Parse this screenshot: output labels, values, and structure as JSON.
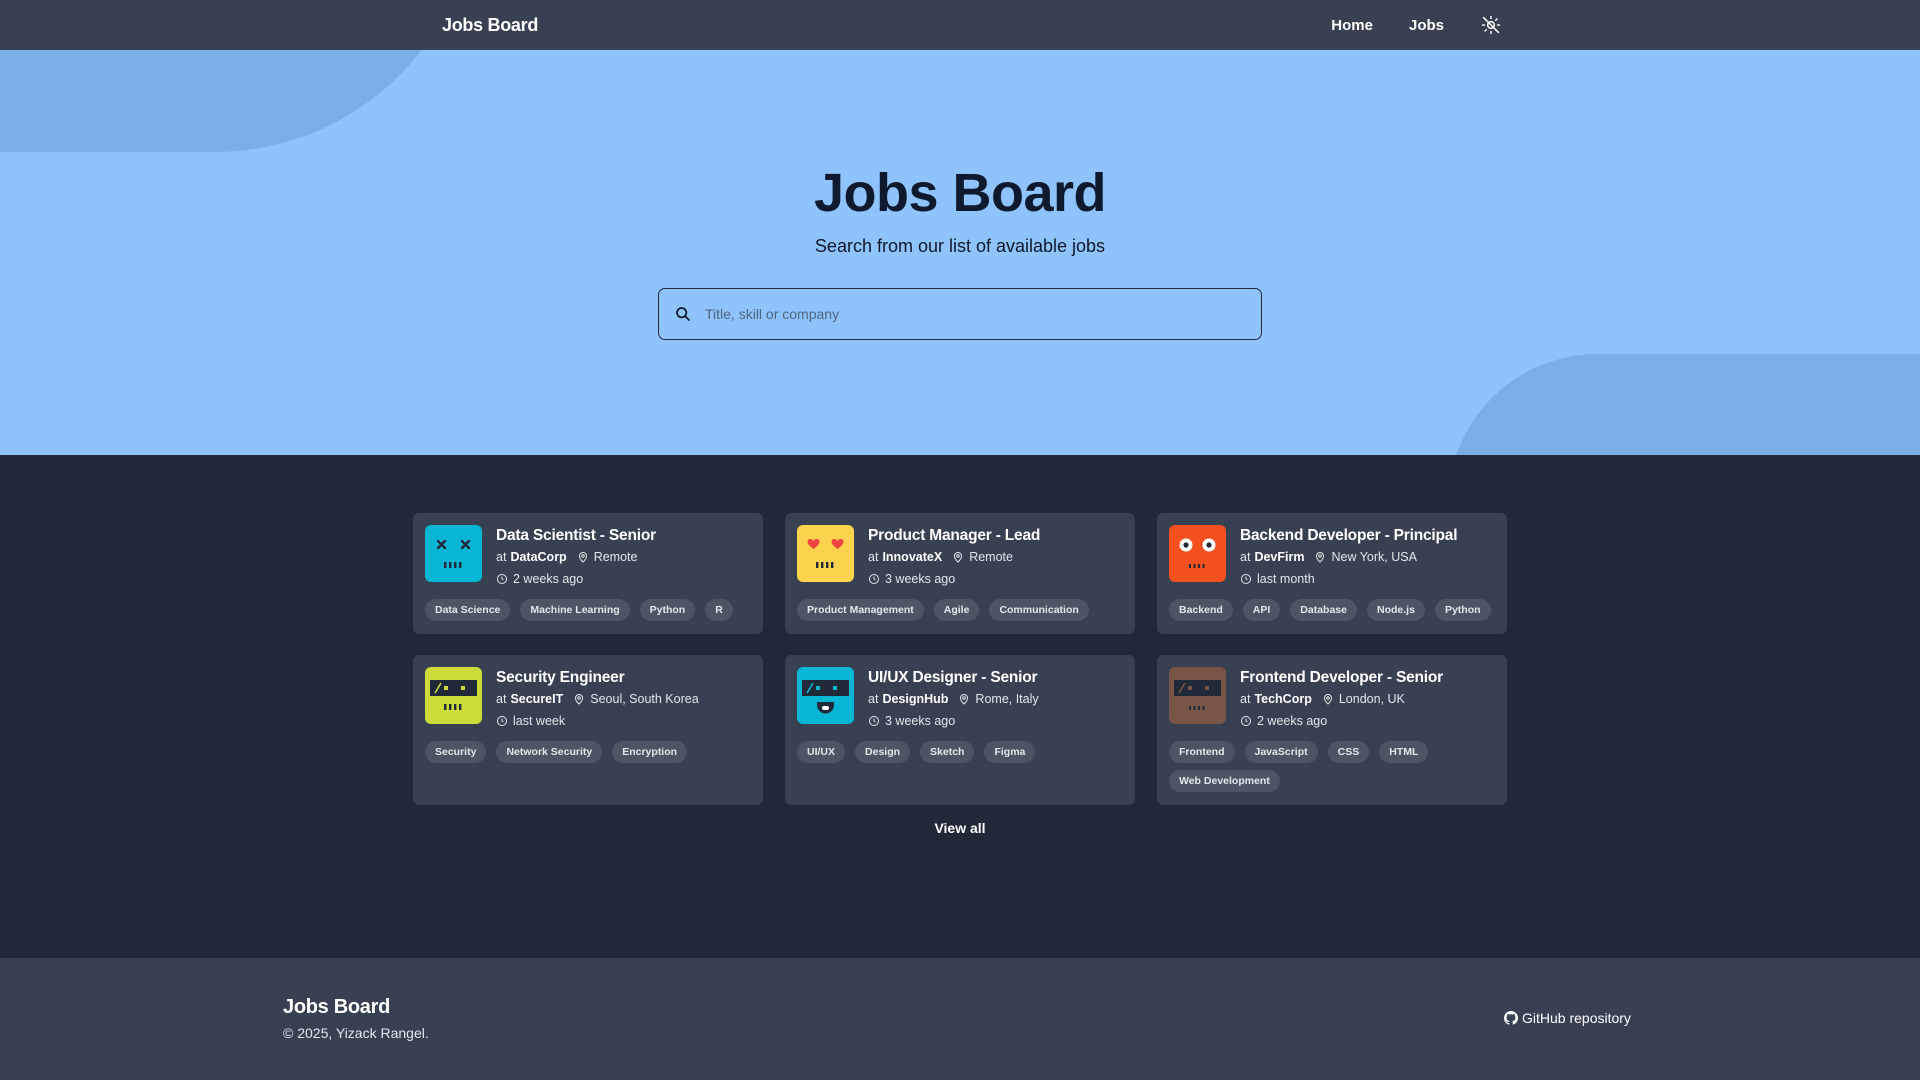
{
  "navbar": {
    "brand": "Jobs Board",
    "links": [
      {
        "label": "Home"
      },
      {
        "label": "Jobs"
      }
    ],
    "theme_toggle_icon": "sun-off-icon"
  },
  "hero": {
    "title": "Jobs Board",
    "subtitle": "Search from our list of available jobs",
    "search": {
      "placeholder": "Title, skill or company",
      "value": "",
      "icon": "search-icon"
    },
    "colors": {
      "background": "#8ec3fc",
      "blob": "#7aaee6"
    }
  },
  "jobs": [
    {
      "title": "Data Scientist - Senior",
      "at": "at",
      "company": "DataCorp",
      "location": "Remote",
      "posted": "2 weeks ago",
      "avatar": {
        "color": "#06b6d4",
        "face": "dead-x-eyes"
      },
      "tags": [
        "Data Science",
        "Machine Learning",
        "Python",
        "R"
      ]
    },
    {
      "title": "Product Manager - Lead",
      "at": "at",
      "company": "InnovateX",
      "location": "Remote",
      "posted": "3 weeks ago",
      "avatar": {
        "color": "#fcd34d",
        "face": "heart-eyes"
      },
      "tags": [
        "Product Management",
        "Agile",
        "Communication"
      ]
    },
    {
      "title": "Backend Developer - Principal",
      "at": "at",
      "company": "DevFirm",
      "location": "New York, USA",
      "posted": "last month",
      "avatar": {
        "color": "#f4511e",
        "face": "round-eyes"
      },
      "tags": [
        "Backend",
        "API",
        "Database",
        "Node.js",
        "Python"
      ]
    },
    {
      "title": "Security Engineer",
      "at": "at",
      "company": "SecureIT",
      "location": "Seoul, South Korea",
      "posted": "last week",
      "avatar": {
        "color": "#cddc39",
        "face": "visor"
      },
      "tags": [
        "Security",
        "Network Security",
        "Encryption"
      ]
    },
    {
      "title": "UI/UX Designer - Senior",
      "at": "at",
      "company": "DesignHub",
      "location": "Rome, Italy",
      "posted": "3 weeks ago",
      "avatar": {
        "color": "#06b6d4",
        "face": "visor-smile"
      },
      "tags": [
        "UI/UX",
        "Design",
        "Sketch",
        "Figma"
      ]
    },
    {
      "title": "Frontend Developer - Senior",
      "at": "at",
      "company": "TechCorp",
      "location": "London, UK",
      "posted": "2 weeks ago",
      "avatar": {
        "color": "#795548",
        "face": "visor"
      },
      "tags": [
        "Frontend",
        "JavaScript",
        "CSS",
        "HTML",
        "Web Development"
      ]
    }
  ],
  "view_all": "View all",
  "footer": {
    "brand": "Jobs Board",
    "copyright": "© 2025, Yizack Rangel.",
    "repo_link": "GitHub repository",
    "repo_icon": "github-icon"
  }
}
